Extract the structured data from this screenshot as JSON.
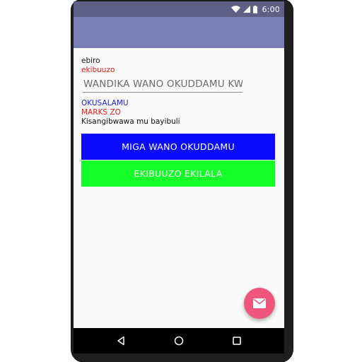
{
  "status_bar": {
    "time": "6:00",
    "icons": [
      "wifi-icon",
      "signal-icon",
      "battery-icon"
    ]
  },
  "content": {
    "question": "ebiro",
    "question_label": "ekibuuzo",
    "answer_input": {
      "placeholder": "WANDIKA WANO OKUDDAMU KWO",
      "value": ""
    },
    "result_label": "OKUSALAMU",
    "marks_label": "MARKS ZO",
    "info_text": "Kisangibwawa mu bayibuli"
  },
  "buttons": {
    "submit_label": "MIGA WANO OKUDDAMU",
    "full_question_label": "EKIBUUZO EKILALA"
  },
  "fab": {
    "icon": "email-icon"
  },
  "nav_bar": {
    "icons": [
      "back-icon",
      "home-icon",
      "recents-icon"
    ]
  },
  "colors": {
    "status_bar": "#5f5f86",
    "app_bar": "#7a7eb6",
    "button_blue": "#0a0aff",
    "button_green": "#14ff2a",
    "fab": "#f0557b",
    "text_red": "#e41b1b",
    "text_blue": "#1d1de0"
  }
}
